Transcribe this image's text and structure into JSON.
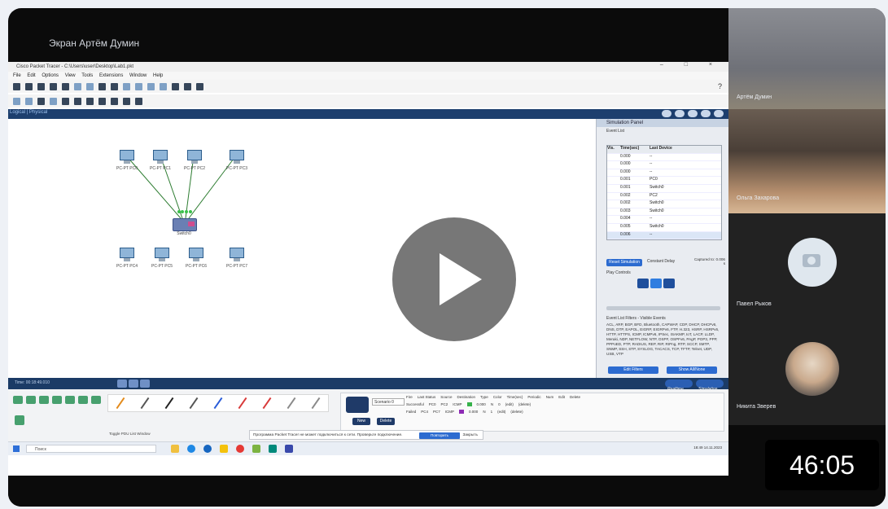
{
  "share": {
    "title": "Экран Артём Думин"
  },
  "app": {
    "window_title": "Cisco Packet Tracer - C:\\Users\\user\\Desktop\\Lab1.pkt",
    "menu": [
      "File",
      "Edit",
      "Options",
      "View",
      "Tools",
      "Extensions",
      "Window",
      "Help"
    ],
    "help": "?",
    "workspace_tab": "Logical",
    "workspace_tab2": "Physical",
    "devices": [
      {
        "label": "PC-PT\nPC0"
      },
      {
        "label": "PC-PT\nPC1"
      },
      {
        "label": "PC-PT\nPC2"
      },
      {
        "label": "PC-PT\nPC3"
      },
      {
        "label": "PC-PT\nPC4"
      },
      {
        "label": "PC-PT\nPC5"
      },
      {
        "label": "PC-PT\nPC6"
      },
      {
        "label": "PC-PT\nPC7"
      }
    ],
    "switch_label": "Switch0",
    "sim_panel": {
      "title": "Simulation Panel",
      "event_list_label": "Event List",
      "columns": [
        "Vis.",
        "Time(sec)",
        "Last Device"
      ],
      "rows": [
        [
          "",
          "0.000",
          "--"
        ],
        [
          "",
          "0.000",
          "--"
        ],
        [
          "",
          "0.000",
          "--"
        ],
        [
          "",
          "0.001",
          "PC0"
        ],
        [
          "",
          "0.001",
          "Switch0"
        ],
        [
          "",
          "0.002",
          "PC2"
        ],
        [
          "",
          "0.002",
          "Switch0"
        ],
        [
          "",
          "0.003",
          "Switch0"
        ],
        [
          "",
          "0.004",
          "--"
        ],
        [
          "",
          "0.005",
          "Switch0"
        ],
        [
          "",
          "0.006",
          "--"
        ]
      ],
      "reset_button": "Reset Simulation",
      "constant_delay": "Constant Delay",
      "captured_to": "Captured to: 0.006 s",
      "play_controls_label": "Play Controls",
      "event_list_filters_label": "Event List Filters - Visible Events",
      "filters_text": "ACL, ARP, BGP, BFD, Bluetooth, CAPWAP, CDP, DHCP, DHCPv6, DNS, DTP, EAPOL, EIGRP, EIGRPv6, FTP, H.323, HSRP, HSRPv6, HTTP, HTTPS, ICMP, ICMPv6, IPSec, ISAKMP, IoT, LACP, LLDP, Meraki, NDP, NETFLOW, NTP, OSPF, OSPFv6, PAgP, POP3, PPP, PPPoED, PTP, RADIUS, REP, RIP, RIPng, RTP, SCCP, SMTP, SNMP, SSH, STP, SYSLOG, TACACS, TCP, TFTP, Telnet, UDP, USB, VTP",
      "edit_filters": "Edit Filters",
      "show_all": "Show All/None"
    },
    "status_bar": {
      "time": "Time: 00:18:49.010",
      "realtime_label": "Realtime",
      "simulation_label": "Simulation"
    },
    "pdu_columns": [
      "Fire",
      "Last Status",
      "Source",
      "Destination",
      "Type",
      "Color",
      "Time(sec)",
      "Periodic",
      "Num",
      "Edit",
      "Delete"
    ],
    "pdu_rows": [
      {
        "fire": "",
        "status": "Successful",
        "source": "PC0",
        "dest": "PC2",
        "type": "ICMP",
        "color": "#36b24a",
        "time": "0.000",
        "periodic": "N",
        "num": "0",
        "edit": "(edit)",
        "delete": "(delete)"
      },
      {
        "fire": "",
        "status": "Failed",
        "source": "PC4",
        "dest": "PC7",
        "type": "ICMP",
        "color": "#8e2bb5",
        "time": "0.000",
        "periodic": "N",
        "num": "1",
        "edit": "(edit)",
        "delete": "(delete)"
      }
    ],
    "scenario": "Scenario 0",
    "new_button": "New",
    "delete_button": "Delete",
    "pdu_list_button": "Toggle PDU List Window",
    "notice": {
      "text": "Программа Packet Tracer не может подключиться к сети. Проверьте подключение.",
      "action": "Повторить",
      "close": "Закрыть"
    },
    "taskbar": {
      "search": "Поиск",
      "clock_time": "18:49",
      "clock_date": "14.11.2023"
    }
  },
  "participants": [
    {
      "name": "Артём Думин"
    },
    {
      "name": "Ольга Захарова"
    },
    {
      "name": "Павел Рыков"
    },
    {
      "name": "Никита Зверев"
    }
  ],
  "timer": "46:05",
  "colors": {
    "ws_bar": "#1d3f6e",
    "link": "#2e7d32",
    "play_bg": "#5f5f5f"
  }
}
